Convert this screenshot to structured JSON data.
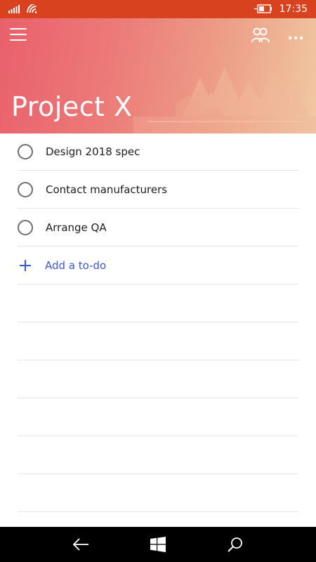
{
  "status_bar": {
    "time": "17:35",
    "icons": [
      "signal-icon",
      "wifi-icon",
      "battery-charging-icon"
    ]
  },
  "header": {
    "title": "Project X",
    "menu_icon": "hamburger-icon",
    "share_icon": "people-icon",
    "more_icon": "more-icon",
    "gradient_colors": [
      "#e9606c",
      "#eda088",
      "#f0c9a2"
    ]
  },
  "todos": [
    {
      "label": "Design 2018 spec"
    },
    {
      "label": "Contact manufacturers"
    },
    {
      "label": "Arrange QA"
    }
  ],
  "add_todo": {
    "label": "Add a to-do",
    "color": "#3955d9"
  },
  "nav_bar": {
    "icons": [
      "back-arrow-icon",
      "windows-start-icon",
      "search-icon"
    ]
  }
}
